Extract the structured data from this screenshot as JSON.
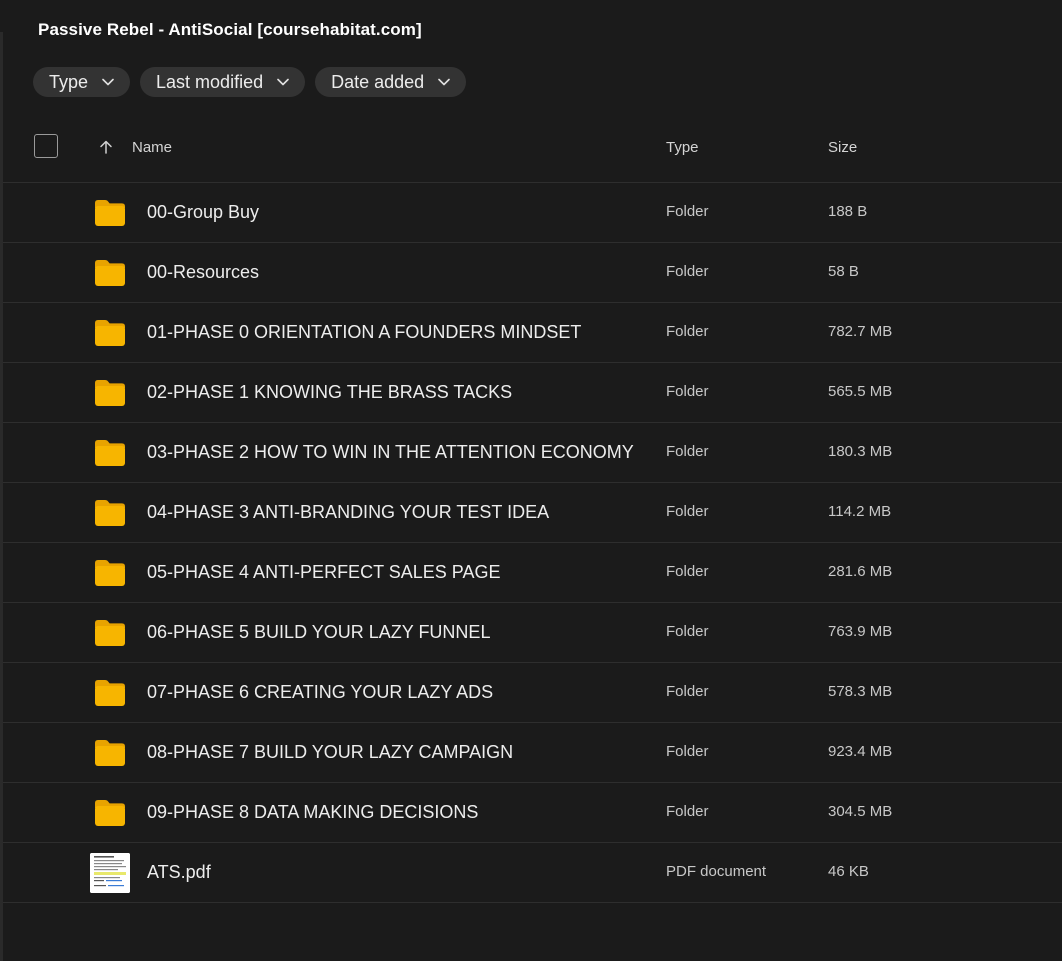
{
  "title": "Passive Rebel - AntiSocial [coursehabitat.com]",
  "filters": [
    {
      "label": "Type"
    },
    {
      "label": "Last modified"
    },
    {
      "label": "Date added"
    }
  ],
  "columns": {
    "name": "Name",
    "type": "Type",
    "size": "Size"
  },
  "colors": {
    "folder": "#f7b500",
    "folder_tab": "#e8a300",
    "background": "#1b1b1b",
    "chip": "#333333"
  },
  "files": [
    {
      "icon": "folder-icon",
      "name": "00-Group Buy",
      "type": "Folder",
      "size": "188 B"
    },
    {
      "icon": "folder-icon",
      "name": "00-Resources",
      "type": "Folder",
      "size": "58 B"
    },
    {
      "icon": "folder-icon",
      "name": "01-PHASE 0 ORIENTATION A FOUNDERS MINDSET",
      "type": "Folder",
      "size": "782.7 MB"
    },
    {
      "icon": "folder-icon",
      "name": "02-PHASE 1 KNOWING THE BRASS TACKS",
      "type": "Folder",
      "size": "565.5 MB"
    },
    {
      "icon": "folder-icon",
      "name": "03-PHASE 2 HOW TO WIN IN THE ATTENTION ECONOMY",
      "type": "Folder",
      "size": "180.3 MB"
    },
    {
      "icon": "folder-icon",
      "name": "04-PHASE 3 ANTI-BRANDING YOUR TEST IDEA",
      "type": "Folder",
      "size": "114.2 MB"
    },
    {
      "icon": "folder-icon",
      "name": "05-PHASE 4 ANTI-PERFECT SALES PAGE",
      "type": "Folder",
      "size": "281.6 MB"
    },
    {
      "icon": "folder-icon",
      "name": "06-PHASE 5 BUILD YOUR LAZY FUNNEL",
      "type": "Folder",
      "size": "763.9 MB"
    },
    {
      "icon": "folder-icon",
      "name": "07-PHASE 6 CREATING YOUR LAZY ADS",
      "type": "Folder",
      "size": "578.3 MB"
    },
    {
      "icon": "folder-icon",
      "name": "08-PHASE 7 BUILD YOUR LAZY CAMPAIGN",
      "type": "Folder",
      "size": "923.4 MB"
    },
    {
      "icon": "folder-icon",
      "name": "09-PHASE 8 DATA MAKING DECISIONS",
      "type": "Folder",
      "size": "304.5 MB"
    },
    {
      "icon": "pdf-thumbnail",
      "name": "ATS.pdf",
      "type": "PDF document",
      "size": "46 KB"
    }
  ]
}
